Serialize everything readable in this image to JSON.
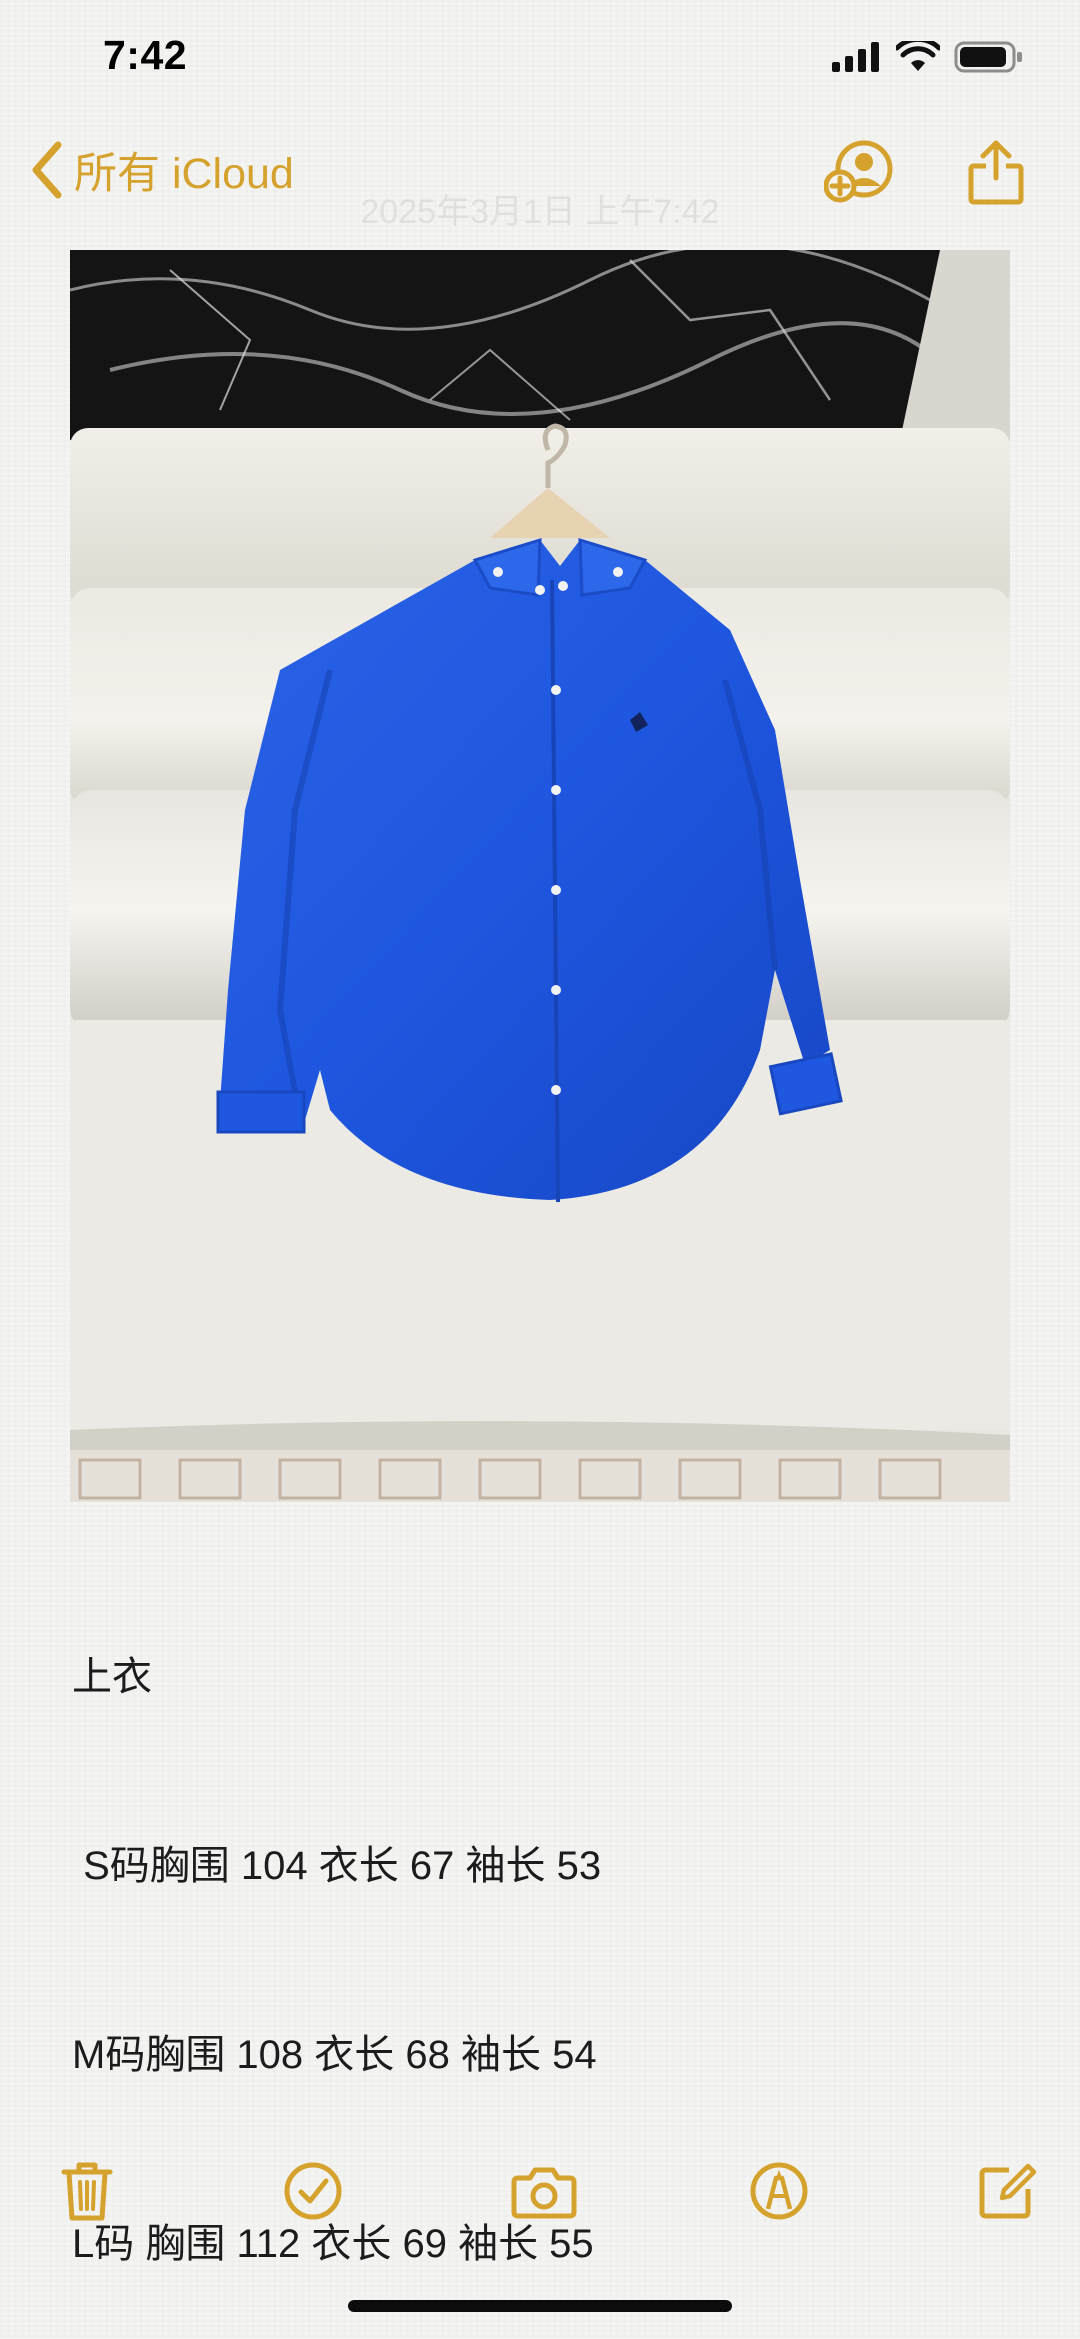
{
  "status_bar": {
    "time": "7:42",
    "signal_icon": "cellular-signal-icon",
    "wifi_icon": "wifi-icon",
    "battery_icon": "battery-icon"
  },
  "nav": {
    "back_label": "所有 iCloud",
    "back_icon": "chevron-left-icon",
    "collab_icon": "add-person-icon",
    "share_icon": "share-icon",
    "accent_color": "#d6a22e"
  },
  "note": {
    "date": "2025年3月1日 上午7:42",
    "image_alt": "Blue long-sleeve button-down shirt on a hanger over a white cushion",
    "lines": [
      "上衣",
      " S码胸围 104 衣长 67 袖长 53",
      "M码胸围 108 衣长 68 袖长 54",
      "L码 胸围 112 衣长 69 袖长 55"
    ]
  },
  "toolbar": {
    "items": [
      "trash-icon",
      "checklist-icon",
      "camera-icon",
      "markup-icon",
      "compose-icon"
    ]
  }
}
